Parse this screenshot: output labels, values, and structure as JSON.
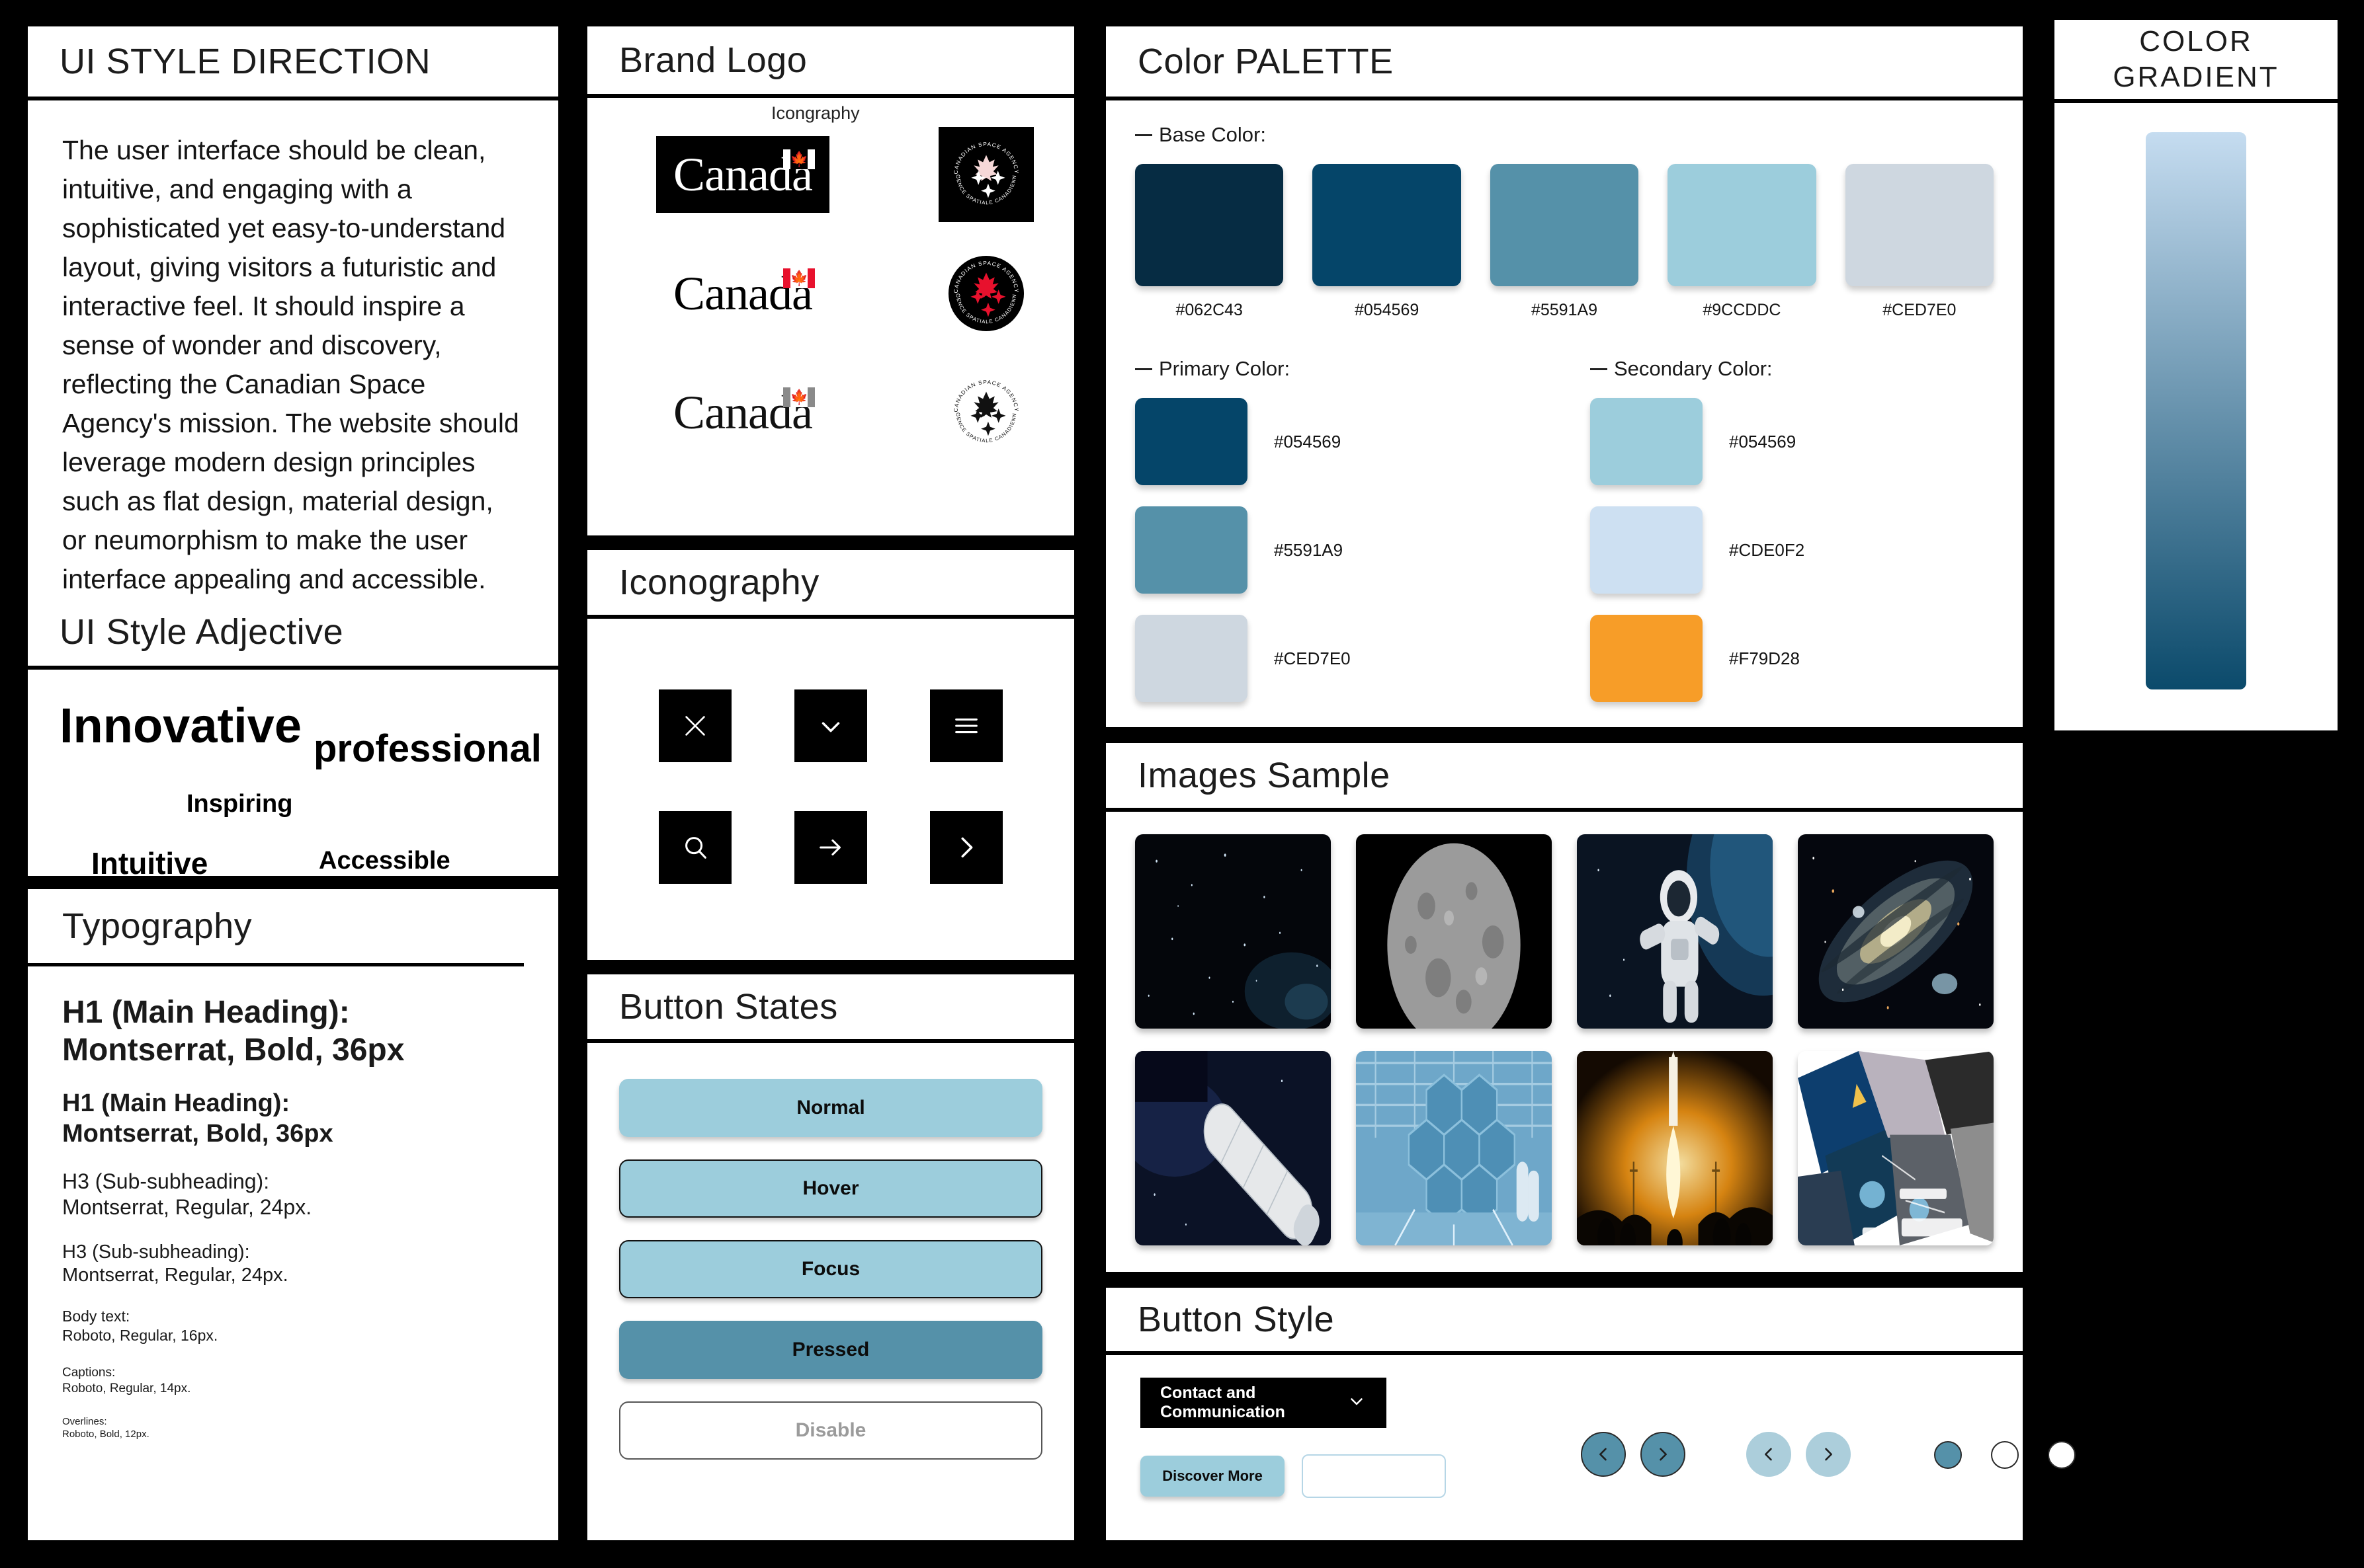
{
  "panels": {
    "direction": {
      "title": "UI STYLE DIRECTION",
      "body": "The user interface should be clean, intuitive, and engaging with a sophisticated yet easy-to-understand layout, giving visitors a futuristic and interactive feel. It should inspire a sense of wonder and discovery, reflecting the Canadian Space Agency's mission. The website should leverage modern design principles such as flat design, material design, or neumorphism to make the user interface appealing and accessible."
    },
    "adjective": {
      "title": "UI Style Adjective",
      "words": [
        "Innovative",
        "professional",
        "Inspiring",
        "Intuitive",
        "Accessible"
      ]
    },
    "typography": {
      "title": "Typography",
      "specs": [
        "H1 (Main Heading):\nMontserrat, Bold, 36px",
        "H1 (Main Heading):\nMontserrat, Bold, 36px",
        "H3 (Sub-subheading):\nMontserrat, Regular, 24px.",
        "H3 (Sub-subheading):\nMontserrat, Regular, 24px.",
        "Body text:\nRoboto, Regular, 16px.",
        "Captions:\nRoboto, Regular, 14px.",
        "Overlines:\nRoboto, Bold, 12px."
      ]
    },
    "brand": {
      "title": "Brand Logo",
      "floating_label": "Icongraphy",
      "wordmark": "Canada",
      "badge_top_text": "CANADIAN SPACE AGENCY",
      "badge_bottom_text": "AGENCE SPATIALE CANADIENNE"
    },
    "iconography": {
      "title": "Iconography",
      "icons": [
        "close-icon",
        "chevron-down-icon",
        "hamburger-menu-icon",
        "search-icon",
        "arrow-right-icon",
        "chevron-right-icon"
      ]
    },
    "button_states": {
      "title": "Button States",
      "states": [
        "Normal",
        "Hover",
        "Focus",
        "Pressed",
        "Disable"
      ]
    },
    "palette": {
      "title": "Color PALETTE",
      "base_label": "Base Color:",
      "primary_label": "Primary Color:",
      "secondary_label": "Secondary Color:",
      "base": [
        {
          "hex": "#062C43"
        },
        {
          "hex": "#054569"
        },
        {
          "hex": "#5591A9"
        },
        {
          "hex": "#9CCDDC"
        },
        {
          "hex": "#CED7E0"
        }
      ],
      "primary": [
        {
          "hex": "#054569",
          "swatch": "#054569"
        },
        {
          "hex": "#5591A9",
          "swatch": "#5591A9"
        },
        {
          "hex": "#CED7E0",
          "swatch": "#CED7E0"
        }
      ],
      "secondary": [
        {
          "hex": "#054569",
          "swatch": "#9CCDDC"
        },
        {
          "hex": "#CDE0F2",
          "swatch": "#CDE0F2"
        },
        {
          "hex": "#F79D28",
          "swatch": "#F79D28"
        }
      ]
    },
    "images": {
      "title": "Images Sample",
      "items": [
        "starfield-nebula",
        "moon-surface",
        "astronaut-spacewalk",
        "andromeda-galaxy",
        "space-station-module",
        "hexagonal-mirror-array",
        "rocket-launch-night",
        "technical-collage"
      ]
    },
    "button_style": {
      "title": "Button Style",
      "dropdown_label": "Contact and Communication",
      "discover_label": "Discover More",
      "input_value": "",
      "input_placeholder": ""
    },
    "gradient": {
      "title": "COLOR GRADIENT",
      "from": "#C5DCF0",
      "to": "#0B4A6B"
    }
  }
}
